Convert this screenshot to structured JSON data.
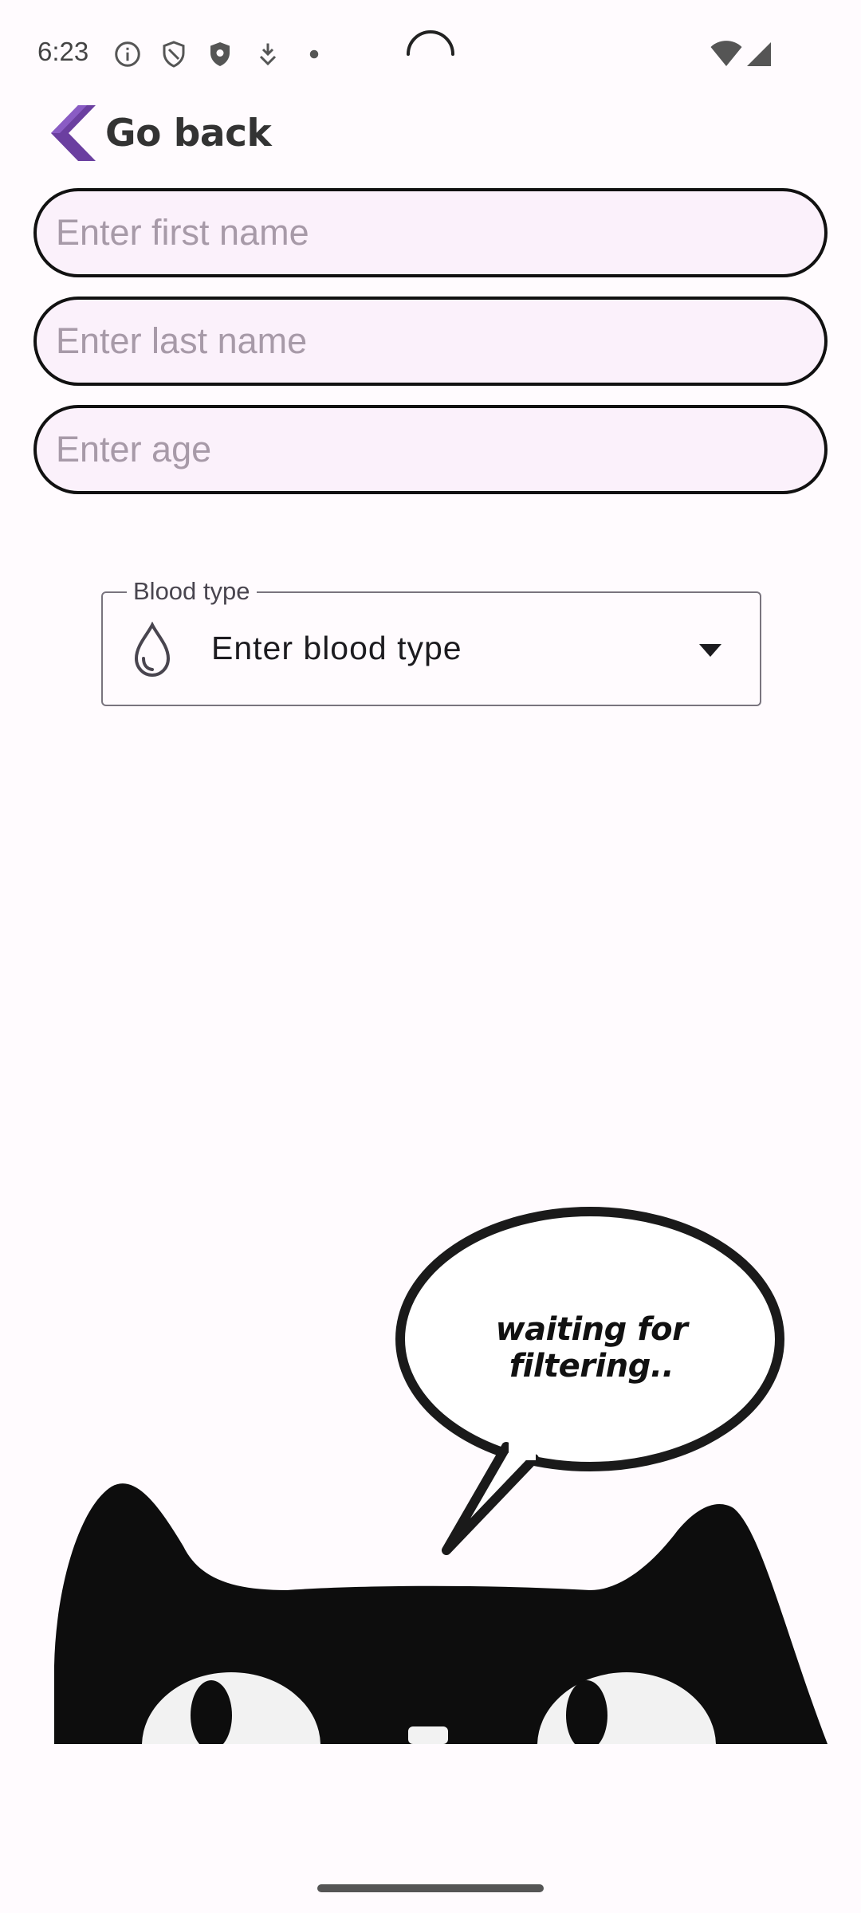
{
  "status_bar": {
    "time": "6:23",
    "icons": [
      "info-icon",
      "shield-outline-icon",
      "shield-filled-icon",
      "download-icon",
      "dot-icon"
    ],
    "right_icons": [
      "wifi-icon",
      "signal-icon"
    ]
  },
  "nav": {
    "back_label": "Go back",
    "accent_color": "#6b3fa0"
  },
  "form": {
    "first_name": {
      "placeholder": "Enter first name",
      "value": ""
    },
    "last_name": {
      "placeholder": "Enter last name",
      "value": ""
    },
    "age": {
      "placeholder": "Enter age",
      "value": ""
    },
    "blood_type": {
      "label": "Blood type",
      "selected": "Enter blood type",
      "icon": "water-drop-icon"
    }
  },
  "illustration": {
    "speech_text": "waiting for filtering.."
  }
}
